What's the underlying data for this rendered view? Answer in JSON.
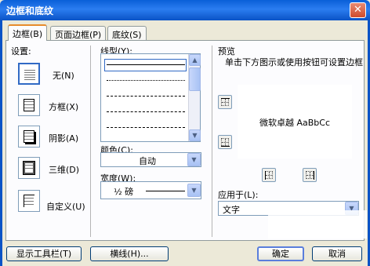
{
  "window": {
    "title": "边框和底纹",
    "close_glyph": "✕"
  },
  "tabs": [
    {
      "label": "边框(B)"
    },
    {
      "label": "页面边框(P)"
    },
    {
      "label": "底纹(S)"
    }
  ],
  "settings": {
    "heading": "设置:",
    "options": [
      {
        "label": "无(N)"
      },
      {
        "label": "方框(X)"
      },
      {
        "label": "阴影(A)"
      },
      {
        "label": "三维(D)"
      },
      {
        "label": "自定义(U)"
      }
    ]
  },
  "line_style": {
    "heading": "线型(Y):"
  },
  "color": {
    "heading": "颜色(C):",
    "value": "自动"
  },
  "width": {
    "heading": "宽度(W):",
    "value": "½ 磅"
  },
  "preview": {
    "heading": "预览",
    "hint": "单击下方图示或使用按钮可设置边框",
    "sample_text": "微软卓越 AaBbCc"
  },
  "apply_to": {
    "heading": "应用于(L):",
    "value": "文字"
  },
  "buttons": {
    "show_toolbar": "显示工具栏(T)",
    "horizontal_line": "横线(H)...",
    "ok": "确定",
    "cancel": "取消"
  },
  "icons": {
    "scroll_up": "▲",
    "scroll_down": "▼",
    "dropdown": "▼"
  }
}
